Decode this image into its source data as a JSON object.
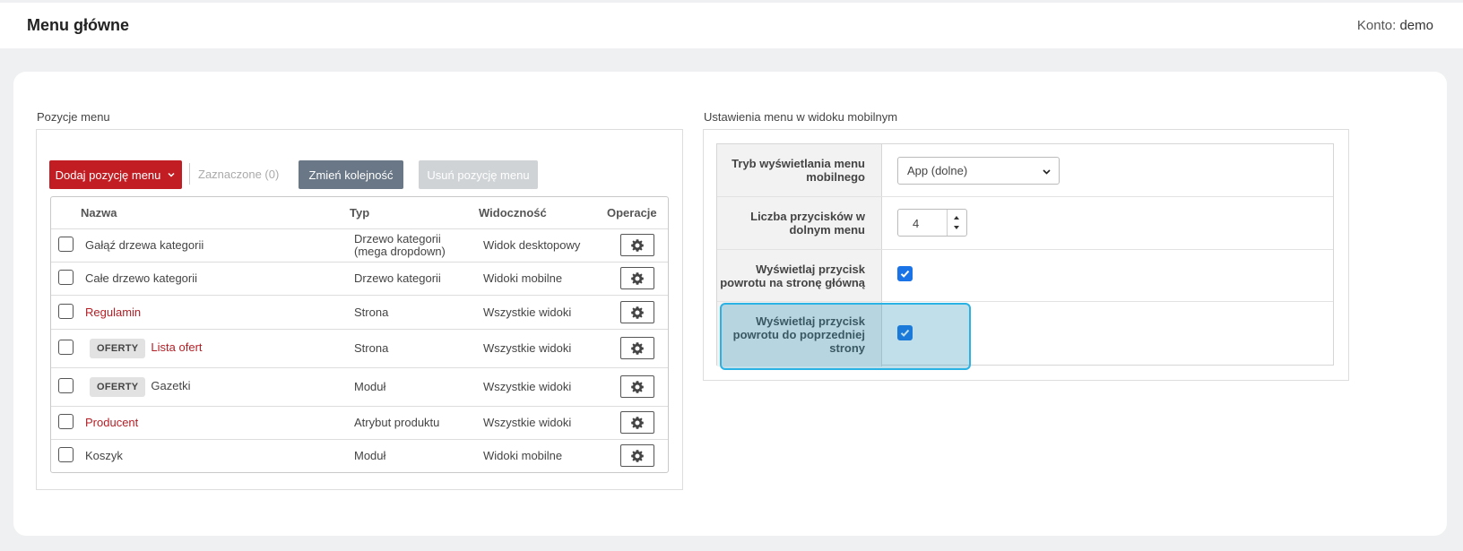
{
  "header": {
    "title": "Menu główne",
    "account_label": "Konto:",
    "account_name": "demo"
  },
  "left": {
    "section_title": "Pozycje menu",
    "add_button": "Dodaj pozycję menu",
    "selected_label": "Zaznaczone (0)",
    "reorder_button": "Zmień kolejność",
    "delete_button": "Usuń pozycję menu",
    "columns": {
      "name": "Nazwa",
      "type": "Typ",
      "visibility": "Widoczność",
      "operations": "Operacje"
    },
    "rows": [
      {
        "tag": "",
        "name": "Gałąź drzewa kategorii",
        "link": false,
        "type_line1": "Drzewo kategorii",
        "type_line2": "(mega dropdown)",
        "visibility": "Widok desktopowy"
      },
      {
        "tag": "",
        "name": "Całe drzewo kategorii",
        "link": false,
        "type_line1": "Drzewo kategorii",
        "type_line2": "",
        "visibility": "Widoki mobilne"
      },
      {
        "tag": "",
        "name": "Regulamin",
        "link": true,
        "type_line1": "Strona",
        "type_line2": "",
        "visibility": "Wszystkie widoki"
      },
      {
        "tag": "OFERTY",
        "name": "Lista ofert",
        "link": true,
        "type_line1": "Strona",
        "type_line2": "",
        "visibility": "Wszystkie widoki"
      },
      {
        "tag": "OFERTY",
        "name": "Gazetki",
        "link": false,
        "type_line1": "Moduł",
        "type_line2": "",
        "visibility": "Wszystkie widoki"
      },
      {
        "tag": "",
        "name": "Producent",
        "link": true,
        "type_line1": "Atrybut produktu",
        "type_line2": "",
        "visibility": "Wszystkie widoki"
      },
      {
        "tag": "",
        "name": "Koszyk",
        "link": false,
        "type_line1": "Moduł",
        "type_line2": "",
        "visibility": "Widoki mobilne"
      }
    ]
  },
  "right": {
    "section_title": "Ustawienia menu w widoku mobilnym",
    "mode_label_1": "Tryb wyświetlania menu",
    "mode_label_2": "mobilnego",
    "mode_value": "App (dolne)",
    "count_label_1": "Liczba przycisków w",
    "count_label_2": "dolnym menu",
    "count_value": "4",
    "home_label_1": "Wyświetlaj przycisk",
    "home_label_2": "powrotu na stronę główną",
    "home_checked": true,
    "back_label_1": "Wyświetlaj przycisk",
    "back_label_2": "powrotu do poprzedniej",
    "back_label_3": "strony",
    "back_checked": true
  },
  "colors": {
    "accent_red": "#c31d24",
    "checkbox_blue": "#1b73e8",
    "highlight": "#2ab2e4"
  }
}
